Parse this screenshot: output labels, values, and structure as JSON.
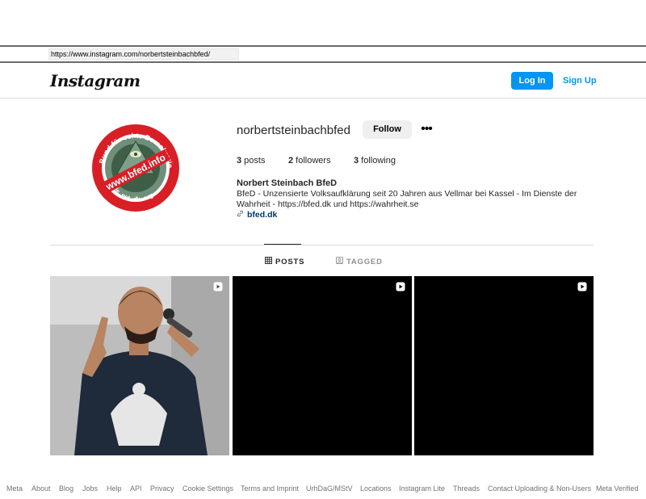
{
  "browser": {
    "url": "https://www.instagram.com/norbertsteinbachbfed/"
  },
  "header": {
    "logo": "Instagram",
    "login_label": "Log In",
    "signup_label": "Sign Up",
    "accent_color": "#0095f6"
  },
  "profile": {
    "username": "norbertsteinbachbfed",
    "follow_label": "Follow",
    "more_label": "•••",
    "stats": {
      "posts_count": "3",
      "posts_label": " posts",
      "followers_count": "2",
      "followers_label": " followers",
      "following_count": "3",
      "following_label": " following"
    },
    "full_name": "Norbert Steinbach BfeD",
    "bio": "BfeD - Unzensierte Volksaufklärung seit 20 Jahren aus Vellmar bei Kassel - Im Dienste der Wahrheit - https://bfed.dk und https://wahrheit.se",
    "link": "bfed.dk",
    "avatar": {
      "ring_text_top": "Bund für echte Demokratie",
      "banner_text": "www.bfed.info",
      "bottom_text": ".de .net .dk .org",
      "small_left": "Postfach 90 2020 34 94",
      "small_right": "Tel. 0561 - 491 84 83"
    }
  },
  "tabs": [
    {
      "label": "POSTS",
      "icon": "grid-icon",
      "active": true
    },
    {
      "label": "TAGGED",
      "icon": "tagged-icon",
      "active": false
    }
  ],
  "posts": [
    {
      "type": "video",
      "icon": "reel-icon"
    },
    {
      "type": "video",
      "icon": "reel-icon"
    },
    {
      "type": "video",
      "icon": "reel-icon"
    }
  ],
  "footer": {
    "links": [
      "Meta",
      "About",
      "Blog",
      "Jobs",
      "Help",
      "API",
      "Privacy",
      "Cookie Settings",
      "Terms and Imprint",
      "UrhDaG/MStV",
      "Locations",
      "Instagram Lite",
      "Threads",
      "Contact Uploading & Non-Users",
      "Meta Verified"
    ]
  }
}
